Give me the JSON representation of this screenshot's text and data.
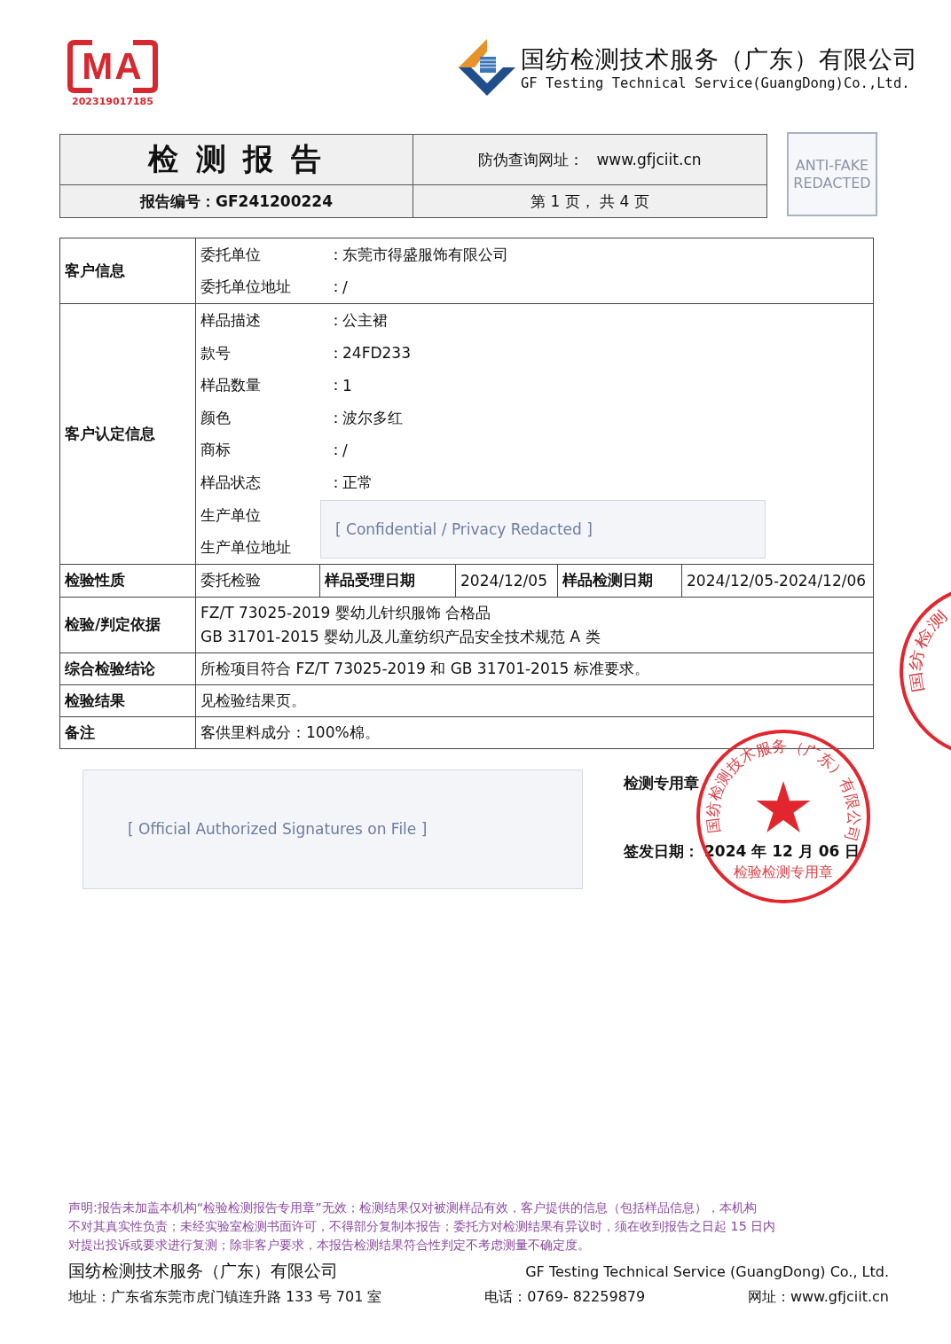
{
  "header": {
    "cma_logo": {
      "letters": "MA",
      "number": "202319017185"
    },
    "company": {
      "name_cn": "国纺检测技术服务（广东）有限公司",
      "name_en": "GF Testing Technical Service(GuangDong)Co.,Ltd."
    }
  },
  "report_header": {
    "title": "检 测 报 告",
    "site_label": "防伪查询网址：",
    "site": "www.gfjciit.cn",
    "report_no_label": "报告编号：",
    "report_no": "GF241200224",
    "page_info": "第 1 页， 共 4 页",
    "anti_fake": "ANTI-FAKE REDACTED"
  },
  "customer_info": {
    "label": "客户信息",
    "fields": [
      {
        "label": "委托单位",
        "separator": "：",
        "value": "东莞市得盛服饰有限公司"
      },
      {
        "label": "委托单位地址",
        "separator": "：",
        "value": "/"
      }
    ]
  },
  "sample_info": {
    "label": "客户认定信息",
    "redaction": "[ Confidential / Privacy Redacted ]",
    "fields": [
      {
        "label": "样品描述",
        "separator": "：",
        "value": "公主裙"
      },
      {
        "label": "款号",
        "separator": "：",
        "value": "24FD233"
      },
      {
        "label": "样品数量",
        "separator": "：",
        "value": "1"
      },
      {
        "label": "颜色",
        "separator": "：",
        "value": "波尔多红"
      },
      {
        "label": "商标",
        "separator": "：",
        "value": "/"
      },
      {
        "label": "样品状态",
        "separator": "：",
        "value": "正常"
      },
      {
        "label": "生产单位"
      },
      {
        "label": "生产单位地址"
      }
    ]
  },
  "inspection_row": {
    "cells": [
      {
        "text": "检验性质",
        "kind": "heading"
      },
      {
        "text": "委托检验",
        "kind": "value"
      },
      {
        "text": "样品受理日期",
        "kind": "heading"
      },
      {
        "text": "2024/12/05",
        "kind": "value"
      },
      {
        "text": "样品检测日期",
        "kind": "heading"
      },
      {
        "text": "2024/12/05-2024/12/06",
        "kind": "value"
      }
    ]
  },
  "result_rows": [
    {
      "label": "检验/判定依据",
      "lines": [
        "FZ/T 73025-2019  婴幼儿针织服饰  合格品",
        "GB 31701-2015  婴幼儿及儿童纺织产品安全技术规范   A 类"
      ]
    },
    {
      "label": "综合检验结论",
      "lines": [
        "所检项目符合 FZ/T 73025-2019 和 GB 31701-2015 标准要求。"
      ]
    },
    {
      "label": "检验结果",
      "lines": [
        "见检验结果页。"
      ]
    },
    {
      "label": "备注",
      "lines": [
        "客供里料成分：100%棉。"
      ]
    }
  ],
  "signature": {
    "placeholder": "[ Official Authorized Signatures on File ]",
    "stamp_label": "检测专用章",
    "issue_date_label": "签发日期：",
    "issue_date": "2024 年 12 月 06 日"
  },
  "stamp": {
    "ring_text": "国纺检测技术服务（广东）有限公司",
    "bottom_text": "检验检测专用章"
  },
  "edge_stamp": {
    "ring_text": "国纺检测"
  },
  "footer": {
    "disclaimer": [
      "声明:报告未加盖本机构“检验检测报告专用章”无效；检测结果仅对被测样品有效，客户提供的信息（包括样品信息），本机构",
      "不对其真实性负责；未经实验室检测书面许可，不得部分复制本报告；委托方对检测结果有异议时，须在收到报告之日起 15 日内",
      "对提出投诉或要求进行复测；除非客户要求，本报告检测结果符合性判定不考虑测量不确定度。"
    ],
    "company_cn": "国纺检测技术服务（广东）有限公司",
    "company_en": "GF Testing Technical Service (GuangDong) Co., Ltd.",
    "address": "地址：广东省东莞市虎门镇连升路 133 号 701 室",
    "phone": "电话：0769- 82259879",
    "website": "网址：www.gfjciit.cn"
  }
}
